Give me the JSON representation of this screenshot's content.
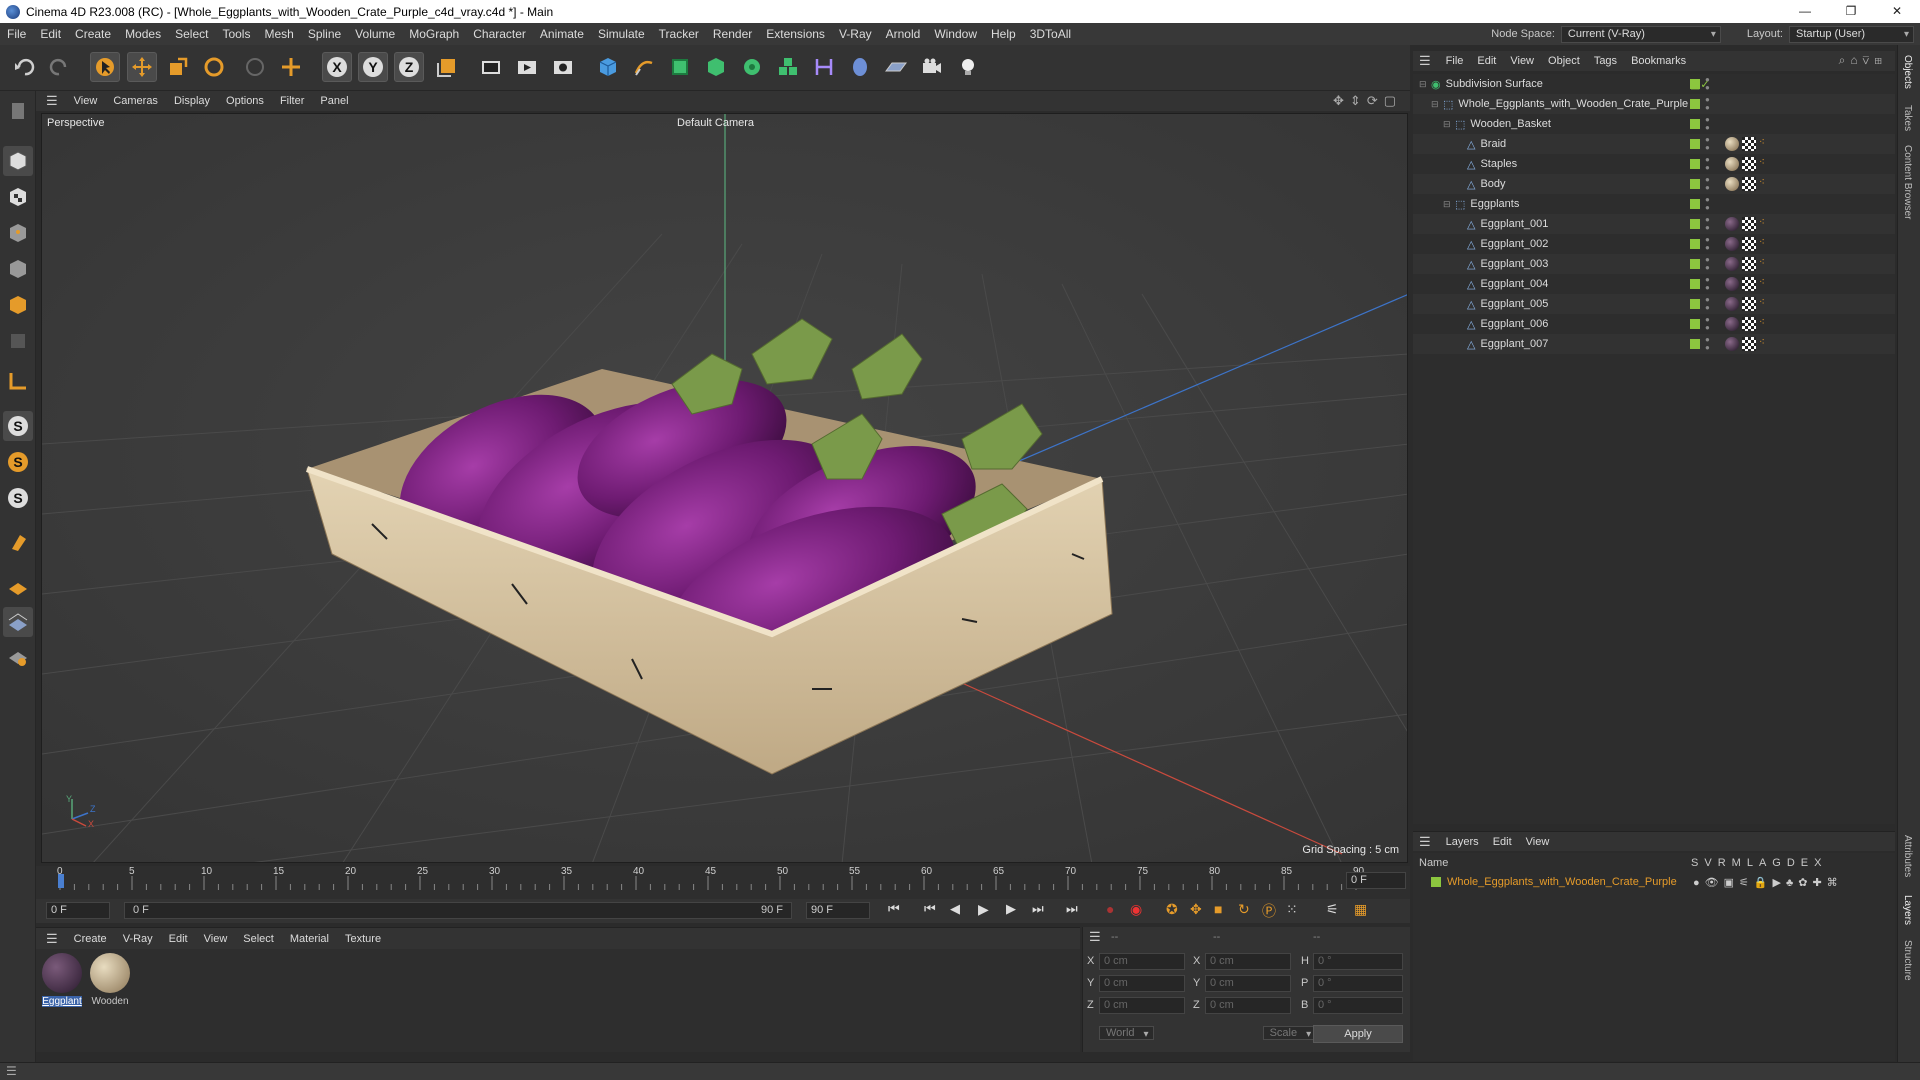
{
  "window": {
    "title": "Cinema 4D R23.008 (RC) - [Whole_Eggplants_with_Wooden_Crate_Purple_c4d_vray.c4d *] - Main",
    "controls": [
      "—",
      "❐",
      "✕"
    ]
  },
  "menubar": {
    "items": [
      "File",
      "Edit",
      "Create",
      "Modes",
      "Select",
      "Tools",
      "Mesh",
      "Spline",
      "Volume",
      "MoGraph",
      "Character",
      "Animate",
      "Simulate",
      "Tracker",
      "Render",
      "Extensions",
      "V-Ray",
      "Arnold",
      "Window",
      "Help",
      "3DToAll"
    ],
    "node_space_label": "Node Space:",
    "node_space_value": "Current (V-Ray)",
    "layout_label": "Layout:",
    "layout_value": "Startup (User)"
  },
  "viewport": {
    "menu": [
      "View",
      "Cameras",
      "Display",
      "Options",
      "Filter",
      "Panel"
    ],
    "view_name": "Perspective",
    "camera_name": "Default Camera",
    "grid_spacing": "Grid Spacing : 5 cm",
    "axis_labels": {
      "y": "Y",
      "z": "Z",
      "x": "X"
    }
  },
  "timeline": {
    "ticks": [
      "0",
      "5",
      "10",
      "15",
      "20",
      "25",
      "30",
      "35",
      "40",
      "45",
      "50",
      "55",
      "60",
      "65",
      "70",
      "75",
      "80",
      "85",
      "90"
    ],
    "current_frame_right": "0 F",
    "start_field": "0 F",
    "range_start": "0 F",
    "range_end": "90 F",
    "end_field": "90 F"
  },
  "material_manager": {
    "menu": [
      "Create",
      "V-Ray",
      "Edit",
      "View",
      "Select",
      "Material",
      "Texture"
    ],
    "materials": [
      {
        "name": "Eggplant",
        "color": "#3a2540"
      },
      {
        "name": "Wooden",
        "color": "#c9b99a"
      }
    ]
  },
  "coordinates": {
    "header": [
      "--",
      "--",
      "--"
    ],
    "rows": [
      {
        "a_label": "X",
        "a_val": "0 cm",
        "b_label": "X",
        "b_val": "0 cm",
        "c_label": "H",
        "c_val": "0 °"
      },
      {
        "a_label": "Y",
        "a_val": "0 cm",
        "b_label": "Y",
        "b_val": "0 cm",
        "c_label": "P",
        "c_val": "0 °"
      },
      {
        "a_label": "Z",
        "a_val": "0 cm",
        "b_label": "Z",
        "b_val": "0 cm",
        "c_label": "B",
        "c_val": "0 °"
      }
    ],
    "mode_world": "World",
    "mode_scale": "Scale",
    "apply": "Apply"
  },
  "object_manager": {
    "menu": [
      "File",
      "Edit",
      "View",
      "Object",
      "Tags",
      "Bookmarks"
    ],
    "objects": [
      {
        "name": "Subdivision Surface",
        "indent": 0
      },
      {
        "name": "Whole_Eggplants_with_Wooden_Crate_Purple",
        "indent": 1
      },
      {
        "name": "Wooden_Basket",
        "indent": 2
      },
      {
        "name": "Braid",
        "indent": 3
      },
      {
        "name": "Staples",
        "indent": 3
      },
      {
        "name": "Body",
        "indent": 3
      },
      {
        "name": "Eggplants",
        "indent": 2
      },
      {
        "name": "Eggplant_001",
        "indent": 3
      },
      {
        "name": "Eggplant_002",
        "indent": 3
      },
      {
        "name": "Eggplant_003",
        "indent": 3
      },
      {
        "name": "Eggplant_004",
        "indent": 3
      },
      {
        "name": "Eggplant_005",
        "indent": 3
      },
      {
        "name": "Eggplant_006",
        "indent": 3
      },
      {
        "name": "Eggplant_007",
        "indent": 3
      }
    ]
  },
  "layer_manager": {
    "menu": [
      "Layers",
      "Edit",
      "View"
    ],
    "columns_label": "Name",
    "flag_columns": [
      "S",
      "V",
      "R",
      "M",
      "L",
      "A",
      "G",
      "D",
      "E",
      "X"
    ],
    "layer_name": "Whole_Eggplants_with_Wooden_Crate_Purple",
    "layer_color": "#8cc63f"
  },
  "side_tabs": [
    "Objects",
    "Takes",
    "Content Browser",
    "Attributes",
    "Layers",
    "Structure"
  ]
}
